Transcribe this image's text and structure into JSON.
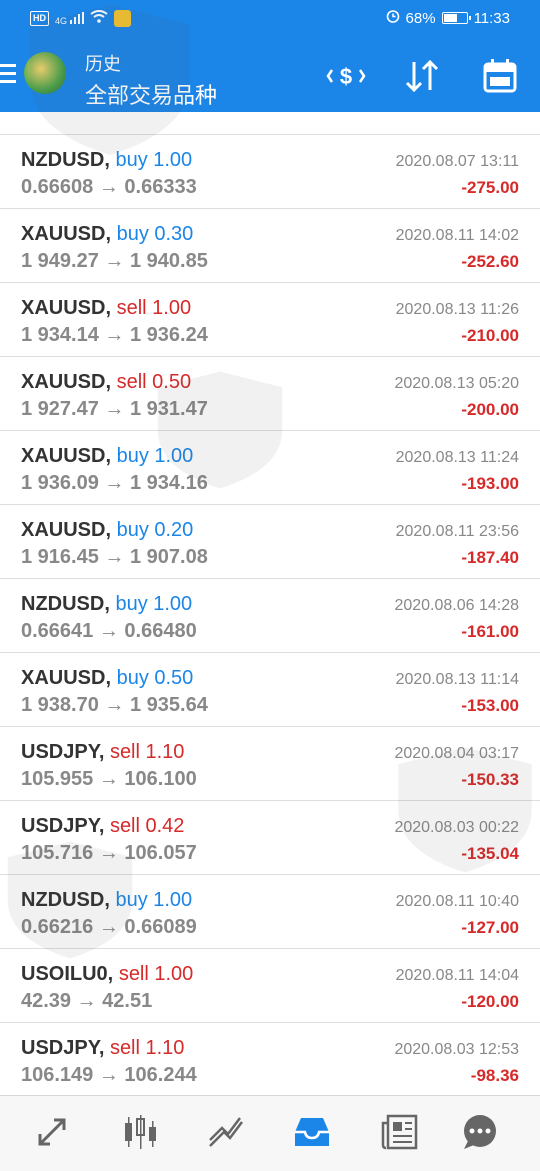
{
  "status_bar": {
    "left_badges": [
      "HD",
      "4G"
    ],
    "battery": "68%",
    "battery_level": 0.68,
    "time": "11:33"
  },
  "header": {
    "title": "历史",
    "subtitle": "全部交易品种",
    "menu_icon": "hamburger-icon",
    "logo_icon": "metatrader-logo",
    "actions": [
      {
        "name": "currency-icon"
      },
      {
        "name": "sort-icon"
      },
      {
        "name": "calendar-icon"
      }
    ]
  },
  "trades": [
    {
      "symbol": "NZDUSD,",
      "side": "buy",
      "side_label": "buy 1.00",
      "prices": "0.66608 → 0.66333",
      "time": "2020.08.07 13:11",
      "profit": "-275.00"
    },
    {
      "symbol": "XAUUSD,",
      "side": "buy",
      "side_label": "buy 0.30",
      "prices": "1 949.27 → 1 940.85",
      "time": "2020.08.11 14:02",
      "profit": "-252.60"
    },
    {
      "symbol": "XAUUSD,",
      "side": "sell",
      "side_label": "sell 1.00",
      "prices": "1 934.14 → 1 936.24",
      "time": "2020.08.13 11:26",
      "profit": "-210.00"
    },
    {
      "symbol": "XAUUSD,",
      "side": "sell",
      "side_label": "sell 0.50",
      "prices": "1 927.47 → 1 931.47",
      "time": "2020.08.13 05:20",
      "profit": "-200.00"
    },
    {
      "symbol": "XAUUSD,",
      "side": "buy",
      "side_label": "buy 1.00",
      "prices": "1 936.09 → 1 934.16",
      "time": "2020.08.13 11:24",
      "profit": "-193.00"
    },
    {
      "symbol": "XAUUSD,",
      "side": "buy",
      "side_label": "buy 0.20",
      "prices": "1 916.45 → 1 907.08",
      "time": "2020.08.11 23:56",
      "profit": "-187.40"
    },
    {
      "symbol": "NZDUSD,",
      "side": "buy",
      "side_label": "buy 1.00",
      "prices": "0.66641 → 0.66480",
      "time": "2020.08.06 14:28",
      "profit": "-161.00"
    },
    {
      "symbol": "XAUUSD,",
      "side": "buy",
      "side_label": "buy 0.50",
      "prices": "1 938.70 → 1 935.64",
      "time": "2020.08.13 11:14",
      "profit": "-153.00"
    },
    {
      "symbol": "USDJPY,",
      "side": "sell",
      "side_label": "sell 1.10",
      "prices": "105.955 → 106.100",
      "time": "2020.08.04 03:17",
      "profit": "-150.33"
    },
    {
      "symbol": "USDJPY,",
      "side": "sell",
      "side_label": "sell 0.42",
      "prices": "105.716 → 106.057",
      "time": "2020.08.03 00:22",
      "profit": "-135.04"
    },
    {
      "symbol": "NZDUSD,",
      "side": "buy",
      "side_label": "buy 1.00",
      "prices": "0.66216 → 0.66089",
      "time": "2020.08.11 10:40",
      "profit": "-127.00"
    },
    {
      "symbol": "USOILU0,",
      "side": "sell",
      "side_label": "sell 1.00",
      "prices": "42.39 → 42.51",
      "time": "2020.08.11 14:04",
      "profit": "-120.00"
    },
    {
      "symbol": "USDJPY,",
      "side": "sell",
      "side_label": "sell 1.10",
      "prices": "106.149 → 106.244",
      "time": "2020.08.03 12:53",
      "profit": "-98.36"
    }
  ],
  "bottom_nav": [
    {
      "name": "quotes-icon",
      "active": false
    },
    {
      "name": "chart-candles-icon",
      "active": false
    },
    {
      "name": "trade-icon",
      "active": false
    },
    {
      "name": "history-icon",
      "active": true
    },
    {
      "name": "news-icon",
      "active": false
    },
    {
      "name": "chat-icon",
      "active": false
    }
  ],
  "colors": {
    "header_bg": "#1b86e8",
    "buy": "#1b86e8",
    "sell": "#d62a2a",
    "profit_negative": "#d62a2a",
    "nav_active": "#1b86e8",
    "nav_inactive": "#666666"
  }
}
